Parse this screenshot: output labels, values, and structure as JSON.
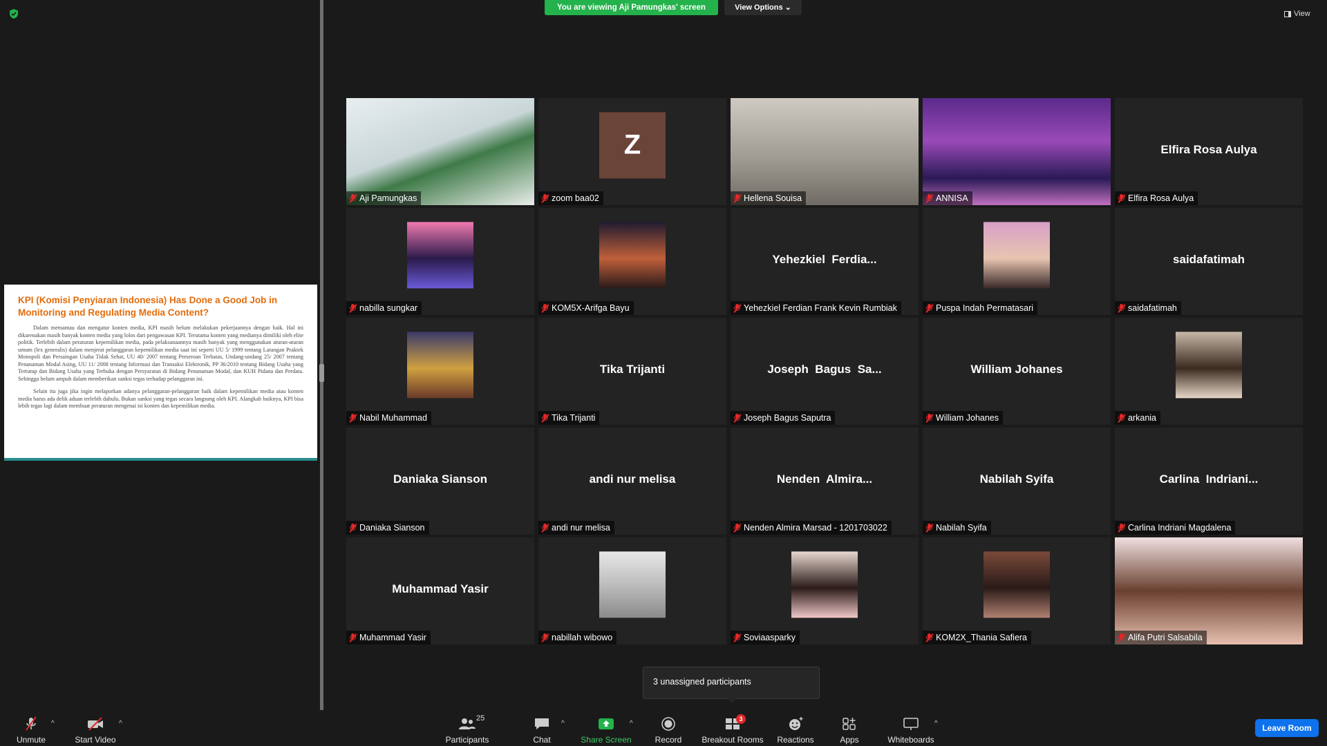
{
  "banner": {
    "text": "You are viewing Aji Pamungkas' screen",
    "view_options": "View Options ⌄",
    "view": "View"
  },
  "slide": {
    "title": "KPI (Komisi Penyiaran Indonesia) Has Done a Good Job in Monitoring and Regulating Media Content?",
    "para1": "Dalam memantau dan mengatur konten media, KPI masih belum melakukan pekerjaannya dengan baik. Hal ini dikarenakan masih banyak konten media yang lolos dari pengawasan KPI. Terutama konten yang medianya dimiliki oleh elite politik. Terlebih dalam peraturan kepemilikan media, pada pelaksanaannya masih banyak yang menggunakan aturan-aturan umum (lex generalis) dalam menjerat pelanggaran kepemilikan media saat ini seperti UU 5/ 1999 tentang Larangan Praktek Monopoli dan Persaingan Usaha Tidak Sehat, UU 40/ 2007 tentang Perseroan Terbatas, Undang-undang 25/ 2007 tentang Penanaman Modal Asing, UU 11/ 2008 tentang Informasi dan Transaksi Elektronik, PP 36/2010 tentang Bidang Usaha yang Tertutup dan Bidang Usaha yang Terbuka dengan Persyaratan di Bidang Penanaman Modal, dan KUH Pidana dan Perdata. Sehingga belum ampuh dalam memberikan sanksi tegas terhadap pelanggaran ini.",
    "para2": "Selain itu juga jika ingin melaporkan adanya pelanggaran-pelanggaran baik dalam kepemilikan media atau konten media harus ada delik aduan terlebih dahulu. Bukan sanksi yang tegas secara langsung oleh KPI. Alangkah baiknya, KPI bisa lebih tegas lagi dalam membuat peraturan mengenai isi konten dan kepemilikan media."
  },
  "tiles": [
    {
      "name": "Aji Pamungkas",
      "kind": "video"
    },
    {
      "name": "zoom baa02",
      "kind": "letter",
      "letter": "Z"
    },
    {
      "name": "Hellena Souisa",
      "kind": "video"
    },
    {
      "name": "ANNISA",
      "kind": "video",
      "active": true
    },
    {
      "name": "Elfira Rosa Aulya",
      "kind": "text",
      "big": "Elfira Rosa Aulya"
    },
    {
      "name": "nabilla sungkar",
      "kind": "photo"
    },
    {
      "name": "KOM5X-Arifga Bayu",
      "kind": "photo"
    },
    {
      "name": "Yehezkiel Ferdian Frank Kevin Rumbiak",
      "kind": "text",
      "big": "Yehezkiel  Ferdia..."
    },
    {
      "name": "Puspa Indah Permatasari",
      "kind": "photo"
    },
    {
      "name": "saidafatimah",
      "kind": "text",
      "big": "saidafatimah"
    },
    {
      "name": "Nabil Muhammad",
      "kind": "photo"
    },
    {
      "name": "Tika Trijanti",
      "kind": "text",
      "big": "Tika Trijanti"
    },
    {
      "name": "Joseph Bagus Saputra",
      "kind": "text",
      "big": "Joseph  Bagus  Sa..."
    },
    {
      "name": "William Johanes",
      "kind": "text",
      "big": "William Johanes"
    },
    {
      "name": "arkania",
      "kind": "photo"
    },
    {
      "name": "Daniaka Sianson",
      "kind": "text",
      "big": "Daniaka Sianson"
    },
    {
      "name": "andi nur melisa",
      "kind": "text",
      "big": "andi nur melisa"
    },
    {
      "name": "Nenden Almira Marsad - 1201703022",
      "kind": "text",
      "big": "Nenden  Almira..."
    },
    {
      "name": "Nabilah Syifa",
      "kind": "text",
      "big": "Nabilah Syifa"
    },
    {
      "name": "Carlina Indriani Magdalena",
      "kind": "text",
      "big": "Carlina  Indriani..."
    },
    {
      "name": "Muhammad Yasir",
      "kind": "text",
      "big": "Muhammad Yasir"
    },
    {
      "name": "nabillah wibowo",
      "kind": "photo"
    },
    {
      "name": "Soviaasparky",
      "kind": "photo"
    },
    {
      "name": "KOM2X_Thania Safiera",
      "kind": "photo"
    },
    {
      "name": "Alifa Putri Salsabila",
      "kind": "video"
    }
  ],
  "tooltip": "3 unassigned participants",
  "toolbar": {
    "unmute": "Unmute",
    "start_video": "Start Video",
    "participants": "Participants",
    "participants_count": "25",
    "chat": "Chat",
    "share_screen": "Share Screen",
    "record": "Record",
    "breakout_rooms": "Breakout Rooms",
    "breakout_badge": "3",
    "reactions": "Reactions",
    "apps": "Apps",
    "whiteboards": "Whiteboards",
    "leave": "Leave Room"
  },
  "colors": {
    "share_green": "#23b24b",
    "leave_blue": "#0e72ed",
    "active_border": "#d8d070",
    "mute_red": "#e02828"
  }
}
